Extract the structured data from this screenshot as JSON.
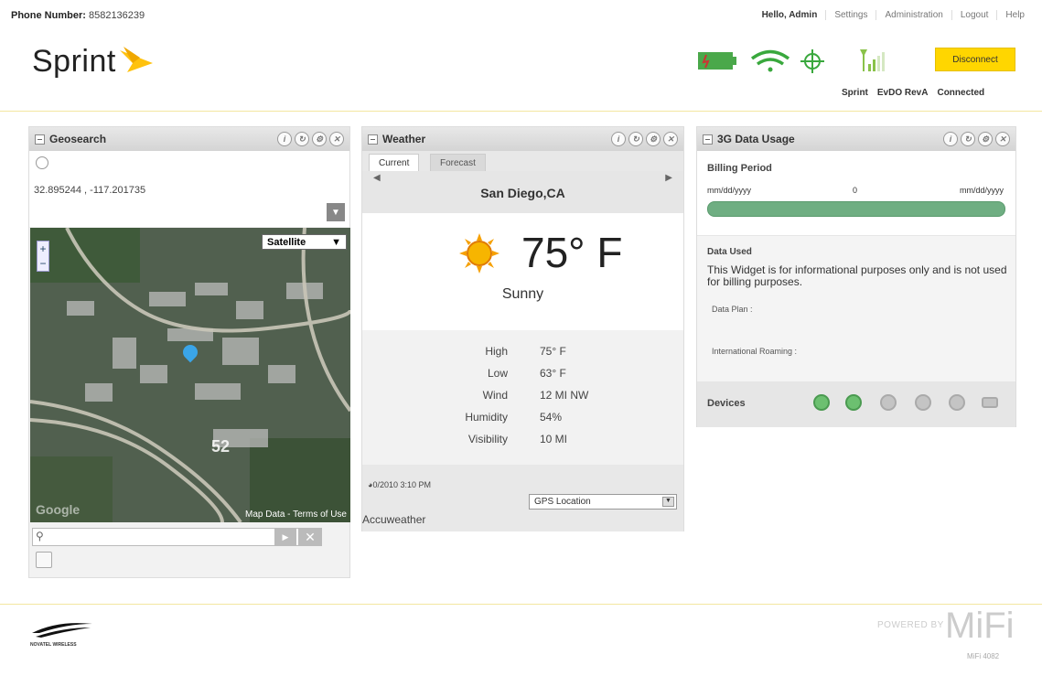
{
  "header": {
    "phone_label": "Phone Number:",
    "phone_value": "8582136239",
    "nav": [
      "Hello, Admin",
      "Settings",
      "Administration",
      "Logout",
      "Help"
    ],
    "brand": "Sprint",
    "disconnect_label": "Disconnect",
    "status": [
      "Sprint",
      "EvDO RevA",
      "Connected"
    ]
  },
  "geosearch": {
    "title": "Geosearch",
    "coords": "32.895244 , -117.201735",
    "map_type": "Satellite",
    "map_terms": "Map Data - Terms of Use",
    "google_logo": "Google",
    "search_placeholder": ""
  },
  "weather": {
    "title": "Weather",
    "tabs": [
      "Current",
      "Forecast"
    ],
    "city": "San Diego,CA",
    "temp": "75° F",
    "condition": "Sunny",
    "details": [
      {
        "k": "High",
        "v": "75° F"
      },
      {
        "k": "Low",
        "v": "63° F"
      },
      {
        "k": "Wind",
        "v": "12 MI NW"
      },
      {
        "k": "Humidity",
        "v": "54%"
      },
      {
        "k": "Visibility",
        "v": "10 MI"
      }
    ],
    "updated": "0/2010 3:10 PM",
    "location_select": "GPS Location",
    "provider": "Accuweather"
  },
  "data_usage": {
    "title": "3G Data Usage",
    "billing_label": "Billing Period",
    "start": "mm/dd/yyyy",
    "middle": "0",
    "end": "mm/dd/yyyy",
    "used_label": "Data Used",
    "message": "This Widget is for informational purposes only and is not used for billing purposes.",
    "plan_label": "Data Plan :",
    "roaming_label": "International Roaming :",
    "devices_label": "Devices"
  },
  "footer": {
    "novatel_tag": "NOVATEL WIRELESS",
    "powered_by": "POWERED BY",
    "mifi": "MiFi",
    "mifi_model": "MiFi 4082"
  },
  "colors": {
    "accent_yellow": "#ffd600",
    "battery_green": "#4aa84a",
    "usage_bar": "#6fae82"
  }
}
